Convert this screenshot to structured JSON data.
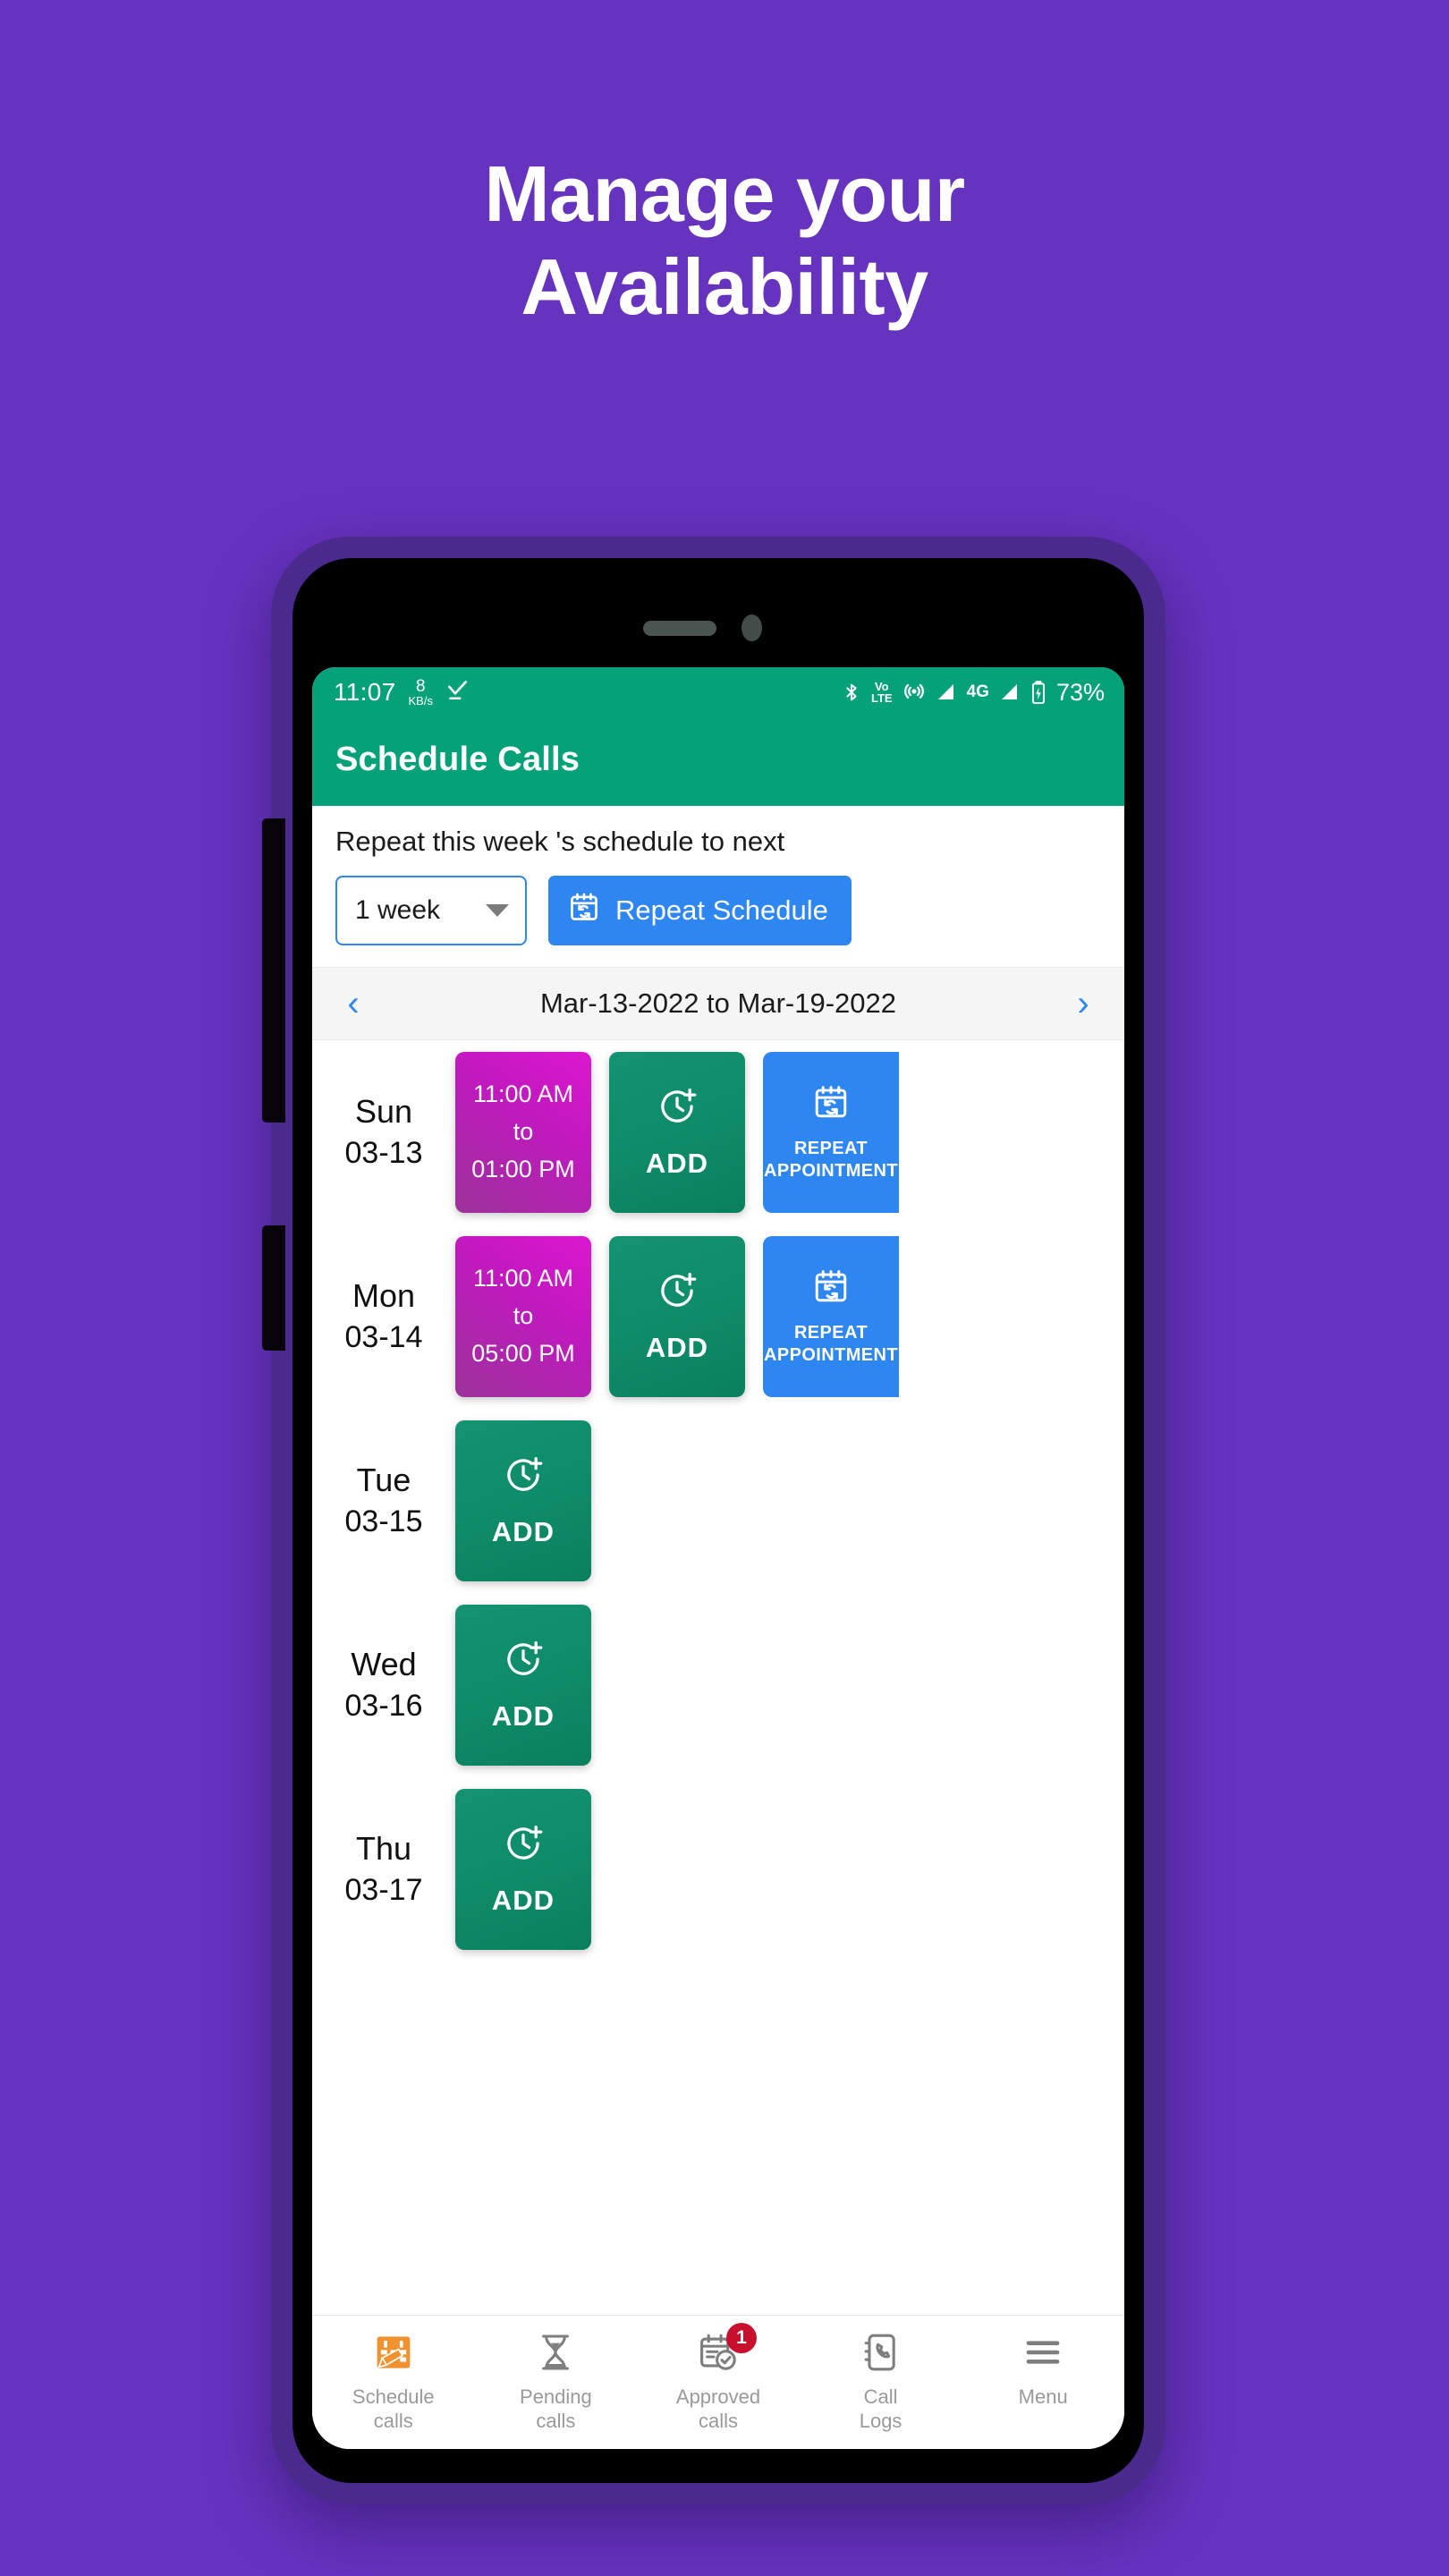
{
  "promo": {
    "line1": "Manage your",
    "line2": "Availability",
    "background_color": "#6633BF"
  },
  "device": {
    "frame_color": "#4B2A8E",
    "bezel_color": "#000000"
  },
  "status_bar": {
    "time": "11:07",
    "net_speed_value": "8",
    "net_speed_unit": "KB/s",
    "download_icon": "download-complete-icon",
    "bluetooth_icon": "bluetooth-icon",
    "volte_top": "Vo",
    "volte_bottom": "LTE",
    "hotspot_icon": "hotspot-icon",
    "signal_1_icon": "signal-bars-icon",
    "network_type": "4G",
    "signal_2_icon": "signal-bars-icon",
    "battery_icon": "battery-charging-icon",
    "battery_level": "73%",
    "background_color": "#05A27A"
  },
  "app_bar": {
    "title": "Schedule Calls",
    "background_color": "#05A27A"
  },
  "repeat_panel": {
    "label": "Repeat this week 's schedule to next",
    "duration_value": "1 week",
    "dropdown_icon": "chevron-down-icon",
    "button_label": "Repeat Schedule",
    "button_icon": "calendar-repeat-icon",
    "button_color": "#2E86F0"
  },
  "week_nav": {
    "prev_icon": "chevron-left-icon",
    "next_icon": "chevron-right-icon",
    "range": "Mar-13-2022 to Mar-19-2022"
  },
  "day_rows": [
    {
      "day": "Sun",
      "date": "03-13",
      "time_card": {
        "start": "11:00 AM",
        "sep": "to",
        "end": "01:00 PM"
      },
      "add_label": "ADD",
      "add_icon": "clock-plus-icon",
      "repeat_card": {
        "line1": "REPEAT",
        "line2": "APPOINTMENT",
        "icon": "calendar-repeat-icon"
      }
    },
    {
      "day": "Mon",
      "date": "03-14",
      "time_card": {
        "start": "11:00 AM",
        "sep": "to",
        "end": "05:00 PM"
      },
      "add_label": "ADD",
      "add_icon": "clock-plus-icon",
      "repeat_card": {
        "line1": "REPEAT",
        "line2": "APPOINTMENT",
        "icon": "calendar-repeat-icon"
      }
    },
    {
      "day": "Tue",
      "date": "03-15",
      "time_card": null,
      "add_label": "ADD",
      "add_icon": "clock-plus-icon",
      "repeat_card": null
    },
    {
      "day": "Wed",
      "date": "03-16",
      "time_card": null,
      "add_label": "ADD",
      "add_icon": "clock-plus-icon",
      "repeat_card": null
    },
    {
      "day": "Thu",
      "date": "03-17",
      "time_card": null,
      "add_label": "ADD",
      "add_icon": "clock-plus-icon",
      "repeat_card": null
    }
  ],
  "bottom_nav": [
    {
      "label": "Schedule\ncalls",
      "icon": "calendar-pencil-icon",
      "badge": null,
      "active": true
    },
    {
      "label": "Pending\ncalls",
      "icon": "hourglass-icon",
      "badge": null,
      "active": false
    },
    {
      "label": "Approved\ncalls",
      "icon": "calendar-check-icon",
      "badge": "1",
      "active": false
    },
    {
      "label": "Call\nLogs",
      "icon": "phone-book-icon",
      "badge": null,
      "active": false
    },
    {
      "label": "Menu",
      "icon": "hamburger-menu-icon",
      "badge": null,
      "active": false
    }
  ],
  "colors": {
    "accent_green": "#05A27A",
    "accent_blue": "#2E86F0",
    "card_magenta": "#C019BE",
    "card_green": "#0E8B68",
    "badge_red": "#C8102E",
    "schedule_icon_orange": "#F0922F"
  }
}
